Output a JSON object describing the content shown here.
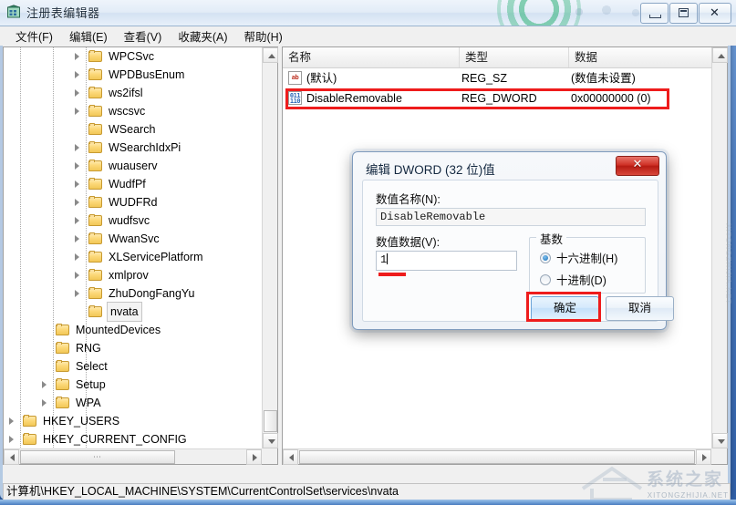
{
  "window": {
    "title": "注册表编辑器",
    "icon": "registry-editor-icon",
    "minimize_label": "最小化",
    "maximize_label": "最大化",
    "close_label": "关闭"
  },
  "menubar": {
    "items": [
      {
        "label": "文件(F)",
        "name": "menu-file"
      },
      {
        "label": "编辑(E)",
        "name": "menu-edit"
      },
      {
        "label": "查看(V)",
        "name": "menu-view"
      },
      {
        "label": "收藏夹(A)",
        "name": "menu-favorites"
      },
      {
        "label": "帮助(H)",
        "name": "menu-help"
      }
    ]
  },
  "tree": {
    "nodes": [
      {
        "label": "WPCSvc",
        "indent": 3,
        "expandable": true,
        "selected": false
      },
      {
        "label": "WPDBusEnum",
        "indent": 3,
        "expandable": true,
        "selected": false
      },
      {
        "label": "ws2ifsl",
        "indent": 3,
        "expandable": true,
        "selected": false
      },
      {
        "label": "wscsvc",
        "indent": 3,
        "expandable": true,
        "selected": false
      },
      {
        "label": "WSearch",
        "indent": 3,
        "expandable": false,
        "selected": false
      },
      {
        "label": "WSearchIdxPi",
        "indent": 3,
        "expandable": true,
        "selected": false
      },
      {
        "label": "wuauserv",
        "indent": 3,
        "expandable": true,
        "selected": false
      },
      {
        "label": "WudfPf",
        "indent": 3,
        "expandable": true,
        "selected": false
      },
      {
        "label": "WUDFRd",
        "indent": 3,
        "expandable": true,
        "selected": false
      },
      {
        "label": "wudfsvc",
        "indent": 3,
        "expandable": true,
        "selected": false
      },
      {
        "label": "WwanSvc",
        "indent": 3,
        "expandable": true,
        "selected": false
      },
      {
        "label": "XLServicePlatform",
        "indent": 3,
        "expandable": true,
        "selected": false
      },
      {
        "label": "xmlprov",
        "indent": 3,
        "expandable": true,
        "selected": false
      },
      {
        "label": "ZhuDongFangYu",
        "indent": 3,
        "expandable": true,
        "selected": false
      },
      {
        "label": "nvata",
        "indent": 3,
        "expandable": false,
        "selected": true
      },
      {
        "label": "MountedDevices",
        "indent": 2,
        "expandable": false,
        "selected": false
      },
      {
        "label": "RNG",
        "indent": 2,
        "expandable": false,
        "selected": false
      },
      {
        "label": "Select",
        "indent": 2,
        "expandable": false,
        "selected": false
      },
      {
        "label": "Setup",
        "indent": 2,
        "expandable": true,
        "selected": false
      },
      {
        "label": "WPA",
        "indent": 2,
        "expandable": true,
        "selected": false
      },
      {
        "label": "HKEY_USERS",
        "indent": 1,
        "expandable": true,
        "selected": false
      },
      {
        "label": "HKEY_CURRENT_CONFIG",
        "indent": 1,
        "expandable": true,
        "selected": false
      }
    ]
  },
  "listview": {
    "columns": [
      {
        "label": "名称",
        "name": "column-name"
      },
      {
        "label": "类型",
        "name": "column-type"
      },
      {
        "label": "数据",
        "name": "column-data"
      }
    ],
    "rows": [
      {
        "icon": "string-value-icon",
        "name": "(默认)",
        "type": "REG_SZ",
        "data": "(数值未设置)",
        "highlighted": false
      },
      {
        "icon": "dword-value-icon",
        "name": "DisableRemovable",
        "type": "REG_DWORD",
        "data": "0x00000000 (0)",
        "highlighted": true
      }
    ]
  },
  "dialog": {
    "title": "编辑 DWORD (32 位)值",
    "close_label": "x",
    "name_label": "数值名称(N):",
    "name_value": "DisableRemovable",
    "data_label": "数值数据(V):",
    "data_value": "1",
    "base_group_label": "基数",
    "radios": [
      {
        "label": "十六进制(H)",
        "selected": true,
        "name": "radio-hexadecimal"
      },
      {
        "label": "十进制(D)",
        "selected": false,
        "name": "radio-decimal"
      }
    ],
    "ok_label": "确定",
    "cancel_label": "取消"
  },
  "statusbar": {
    "path": "计算机\\HKEY_LOCAL_MACHINE\\SYSTEM\\CurrentControlSet\\services\\nvata"
  },
  "scrollbars": {
    "tree_h_thumb_glyph": "⋯",
    "list_h_thumb_glyph": ""
  },
  "watermark": {
    "brand_cn": "系统之家",
    "brand_en": "XITONGZHIJIA.NET",
    "side_text": "XITONGZHIJIA.NET"
  },
  "colors": {
    "annotation_red": "#ee1c1c",
    "title_blue": "#2f5ea6",
    "accent_green": "#2bb076"
  }
}
